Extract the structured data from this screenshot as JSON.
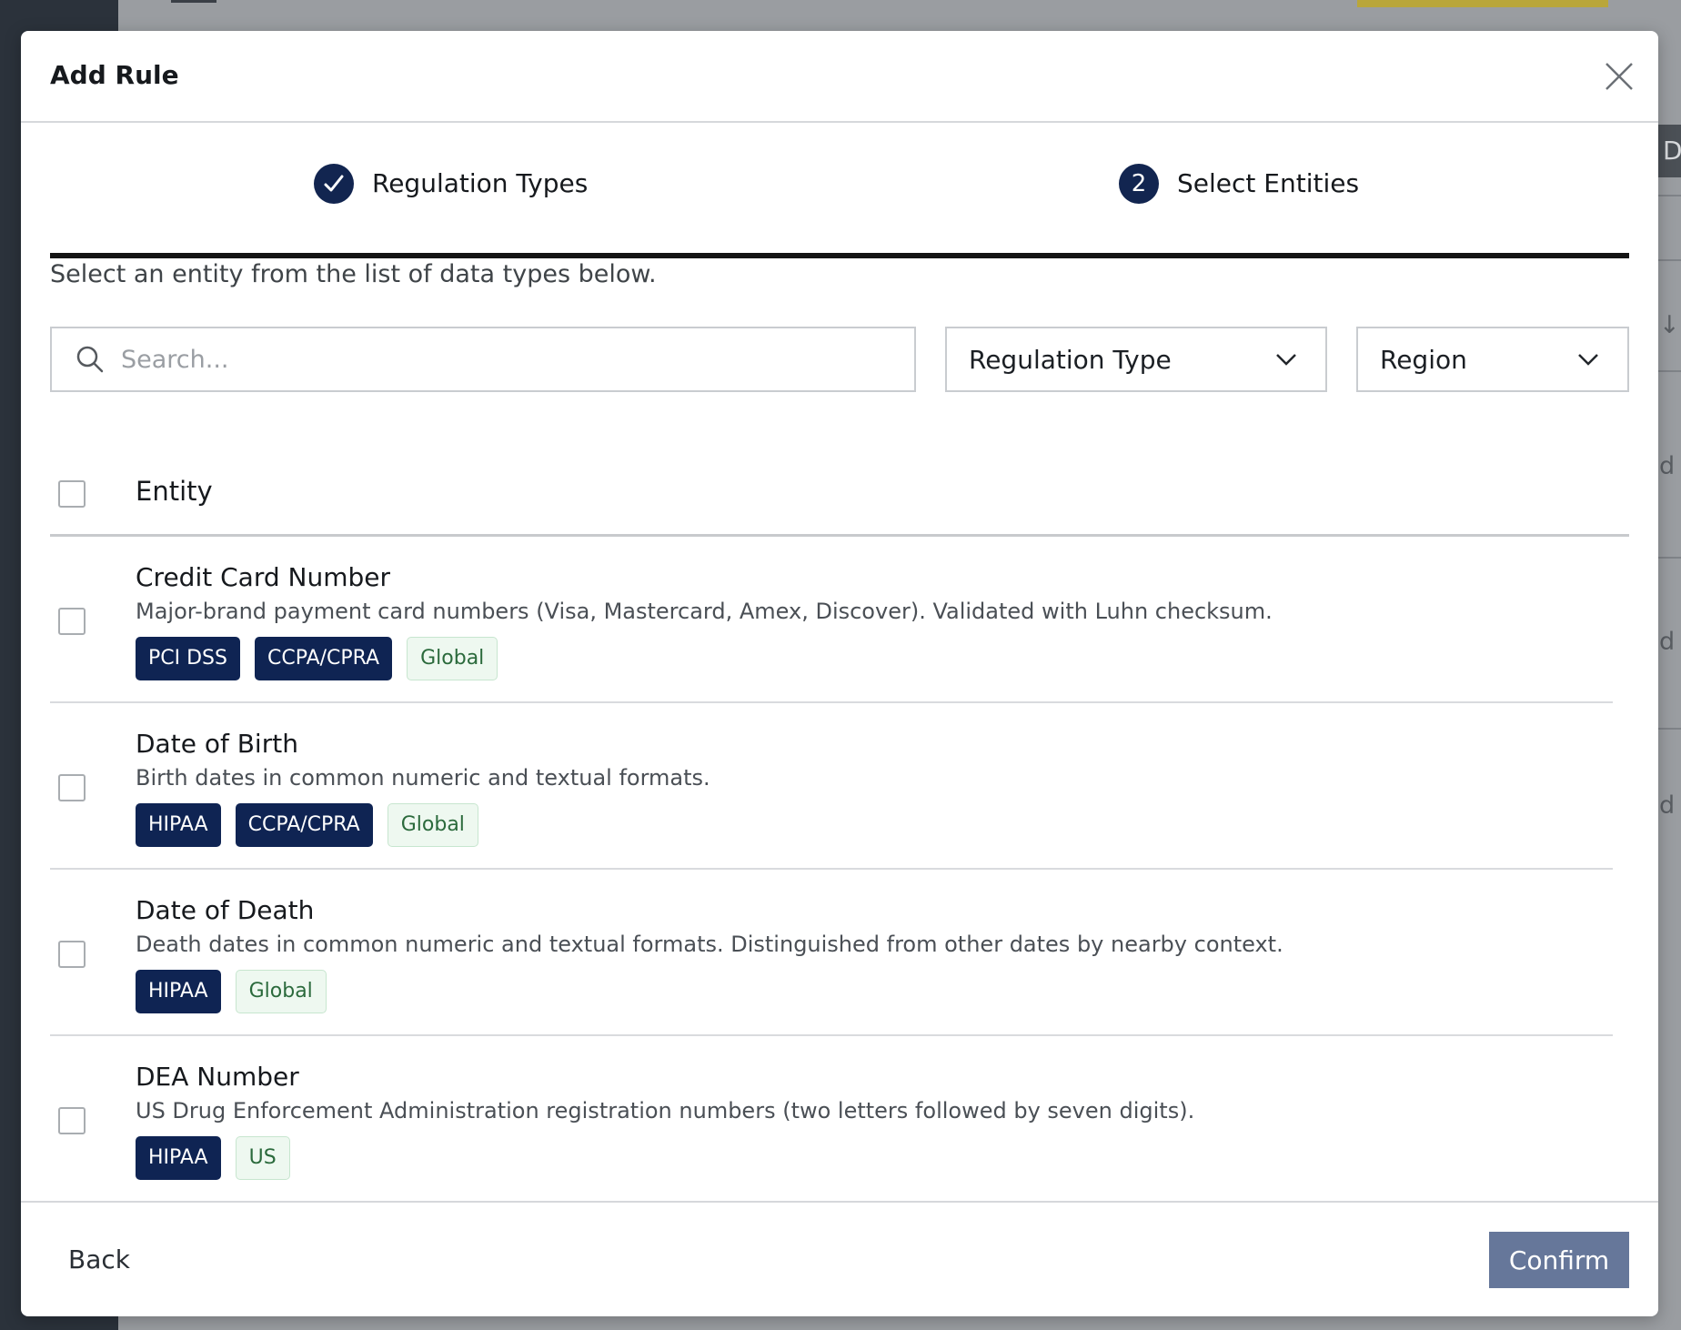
{
  "modal": {
    "title": "Add Rule"
  },
  "stepper": {
    "steps": [
      {
        "label": "Regulation Types",
        "state": "complete"
      },
      {
        "label": "Select Entities",
        "number": "2",
        "state": "active"
      }
    ]
  },
  "instructions": "Select an entity from the list of data types below.",
  "filters": {
    "search_placeholder": "Search...",
    "search_value": "",
    "regulation_type": "Regulation Type",
    "region": "Region"
  },
  "table": {
    "header": "Entity",
    "rows": [
      {
        "title": "Credit Card Number",
        "description": "Major-brand payment card numbers (Visa, Mastercard, Amex, Discover). Validated with Luhn checksum.",
        "regulations": [
          "PCI DSS",
          "CCPA/CPRA"
        ],
        "region": "Global"
      },
      {
        "title": "Date of Birth",
        "description": "Birth dates in common numeric and textual formats.",
        "regulations": [
          "HIPAA",
          "CCPA/CPRA"
        ],
        "region": "Global"
      },
      {
        "title": "Date of Death",
        "description": "Death dates in common numeric and textual formats. Distinguished from other dates by nearby context.",
        "regulations": [
          "HIPAA"
        ],
        "region": "Global"
      },
      {
        "title": "DEA Number",
        "description": "US Drug Enforcement Administration registration numbers (two letters followed by seven digits).",
        "regulations": [
          "HIPAA"
        ],
        "region": "US"
      }
    ]
  },
  "footer": {
    "back_label": "Back",
    "confirm_label": "Confirm"
  },
  "background": {
    "right_tab_letter": "D",
    "right_letters": [
      "d",
      "d",
      "d"
    ],
    "sort_glyph": "↓"
  },
  "colors": {
    "primary_navy": "#122550",
    "confirm_button": "#66779a",
    "region_tag_bg": "#eef8f0",
    "region_tag_text": "#2b6a3c"
  }
}
